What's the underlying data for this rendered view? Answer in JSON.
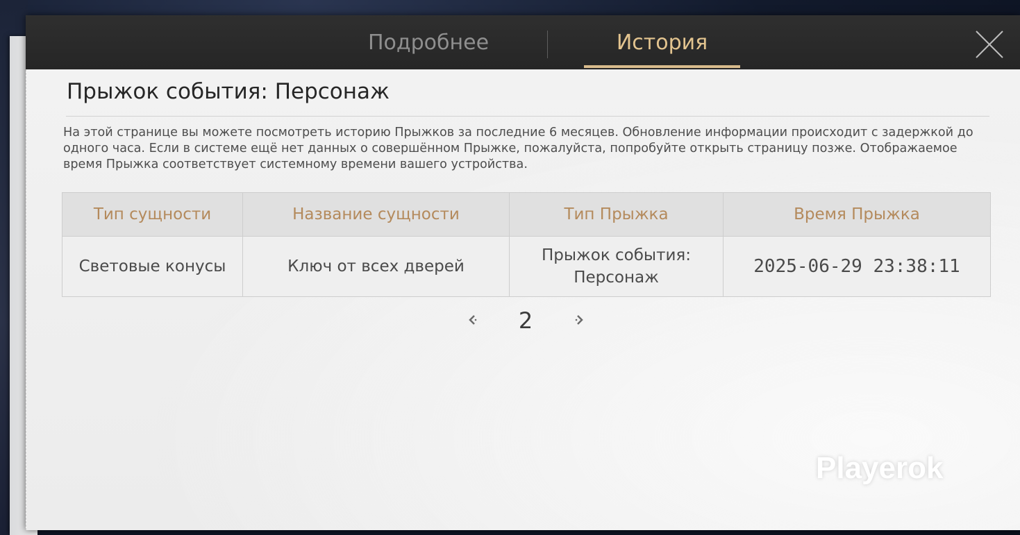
{
  "tabs": {
    "details_label": "Подробнее",
    "history_label": "История",
    "active": "history"
  },
  "colors": {
    "accent": "#d8bb8c",
    "header_bg": "#2b2b2b",
    "table_header_text": "#b48a5c"
  },
  "icons": {
    "close": "close-icon",
    "prev": "chevron-left-icon",
    "next": "chevron-right-icon"
  },
  "page_title": "Прыжок события: Персонаж",
  "info_text": "На этой странице вы можете посмотреть историю Прыжков за последние 6 месяцев. Обновление информации происходит с задержкой до одного часа. Если в системе ещё нет данных о совершённом Прыжке, пожалуйста, попробуйте открыть страницу позже. Отображаемое время Прыжка соответствует системному времени вашего устройства.",
  "table": {
    "columns": [
      "Тип сущности",
      "Название сущности",
      "Тип Прыжка",
      "Время Прыжка"
    ],
    "rows": [
      [
        "Световые конусы",
        "Ключ от всех дверей",
        "Прыжок события: Персонаж",
        "2025-06-29 23:38:11"
      ]
    ]
  },
  "pagination": {
    "current_page": "2"
  },
  "watermark": "Playerok"
}
